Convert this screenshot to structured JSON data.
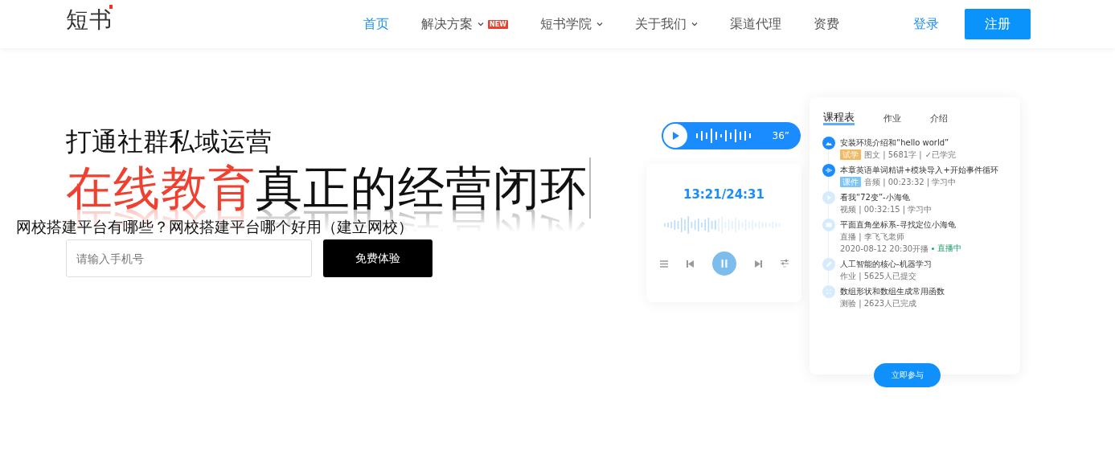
{
  "header": {
    "logo": "短书",
    "nav": [
      {
        "label": "首页",
        "selected": true,
        "dropdown": false
      },
      {
        "label": "解决方案",
        "selected": false,
        "dropdown": true,
        "badge": "NEW"
      },
      {
        "label": "短书学院",
        "selected": false,
        "dropdown": true
      },
      {
        "label": "关于我们",
        "selected": false,
        "dropdown": true
      },
      {
        "label": "渠道代理",
        "selected": false,
        "dropdown": false
      },
      {
        "label": "资费",
        "selected": false,
        "dropdown": false
      }
    ],
    "login": "登录",
    "register": "注册"
  },
  "hero": {
    "subtitle": "打通社群私域运营",
    "title_highlight": "在线教育",
    "title_rest": "真正的经营闭环",
    "overlay_text": "网校搭建平台有哪些？网校搭建平台哪个好用（建立网校）",
    "phone": {
      "placeholder": "请输入手机号"
    },
    "cta": "免费体验"
  },
  "illustration": {
    "voice": {
      "duration": "36”"
    },
    "player": {
      "time": "13:21/24:31"
    },
    "course": {
      "tabs": [
        {
          "label": "课程表",
          "selected": true
        },
        {
          "label": "作业",
          "selected": false
        },
        {
          "label": "介绍",
          "selected": false
        }
      ],
      "lessons": [
        {
          "kind": "image",
          "active": true,
          "title": "安装环境介绍和“hello world”",
          "tag": "试学",
          "color": "#f5b862",
          "meta": "图文 | 5681字 |",
          "status": "✓已学完"
        },
        {
          "kind": "audio",
          "active": true,
          "title": "本章英语单词精讲+模块导入+开始事件循环",
          "tag": "课件",
          "color": "#7cc4fa",
          "meta": "音频 | 00:23:32 | 学习中"
        },
        {
          "kind": "video",
          "active": false,
          "title": "看我“72变”-小海龟",
          "meta": "视频 | 00:32:15 | 学习中"
        },
        {
          "kind": "live",
          "active": false,
          "title": "平面直角坐标系-寻找定位小海龟",
          "meta": "直播 | 李飞飞老师",
          "schedule": "2020-08-12 20:30开播",
          "live": "直播中"
        },
        {
          "kind": "pen",
          "active": false,
          "title": "人工智能的核心-机器学习",
          "meta": "作业 | 5625人已提交"
        },
        {
          "kind": "quiz",
          "active": false,
          "title": "数组形状和数组生成常用函数",
          "meta": "测验 | 2623人已完成"
        }
      ],
      "join": "立即参与"
    }
  }
}
